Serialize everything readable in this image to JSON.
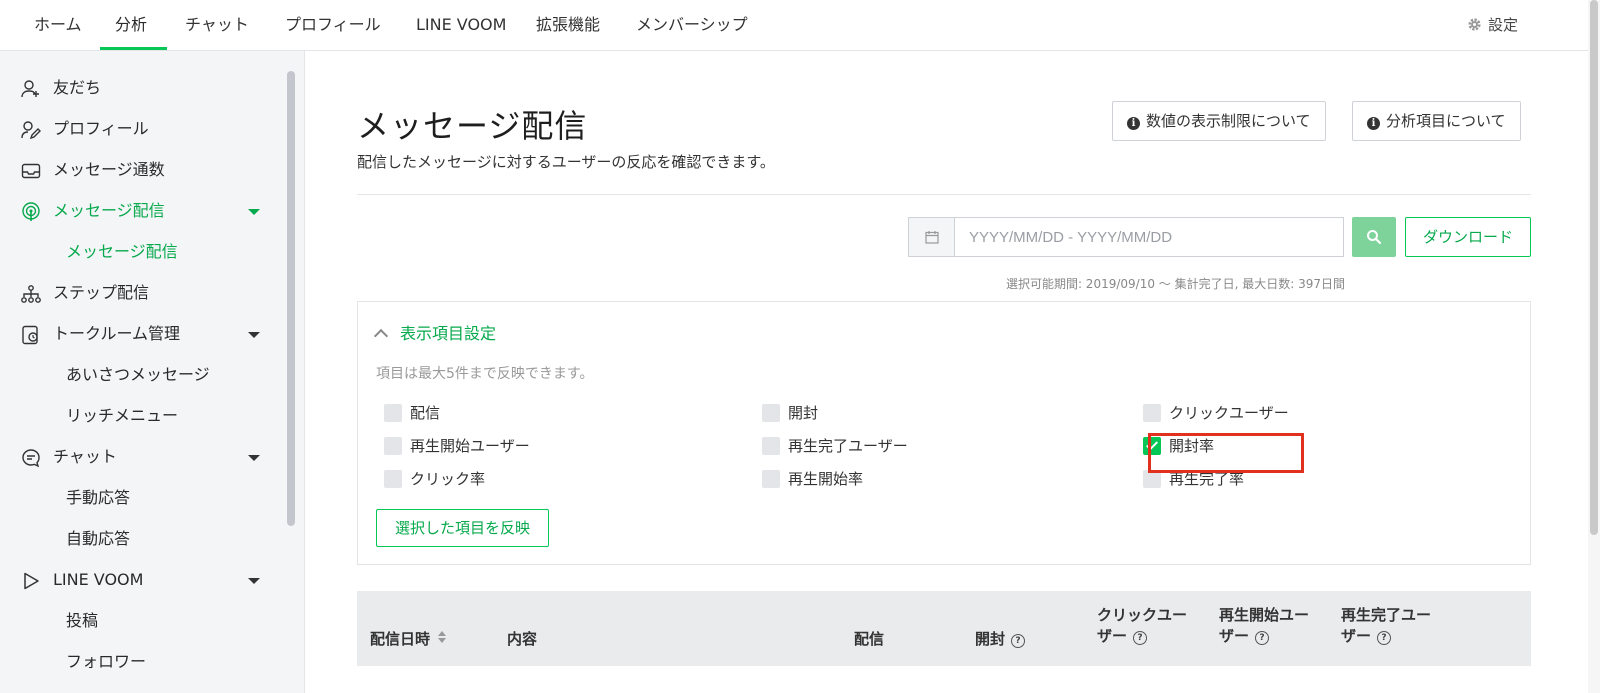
{
  "nav": {
    "tabs": [
      {
        "label": "ホーム"
      },
      {
        "label": "分析"
      },
      {
        "label": "チャット"
      },
      {
        "label": "プロフィール"
      },
      {
        "label": "LINE VOOM"
      },
      {
        "label": "拡張機能"
      },
      {
        "label": "メンバーシップ"
      }
    ],
    "active_tab": "分析",
    "settings_label": "設定"
  },
  "sidebar": {
    "items": [
      {
        "label": "友だち",
        "icon": "user-plus-icon"
      },
      {
        "label": "プロフィール",
        "icon": "profile-edit-icon"
      },
      {
        "label": "メッセージ通数",
        "icon": "inbox-icon"
      },
      {
        "label": "メッセージ配信",
        "icon": "broadcast-icon",
        "active": true
      },
      {
        "label": "メッセージ配信",
        "sub": true,
        "active": true
      },
      {
        "label": "ステップ配信",
        "icon": "step-tree-icon"
      },
      {
        "label": "トークルーム管理",
        "icon": "talkroom-icon"
      },
      {
        "label": "あいさつメッセージ",
        "sub": true
      },
      {
        "label": "リッチメニュー",
        "sub": true
      },
      {
        "label": "チャット",
        "icon": "chat-bubble-icon"
      },
      {
        "label": "手動応答",
        "sub": true
      },
      {
        "label": "自動応答",
        "sub": true
      },
      {
        "label": "LINE VOOM",
        "icon": "voom-play-icon"
      },
      {
        "label": "投稿",
        "sub": true
      },
      {
        "label": "フォロワー",
        "sub": true
      }
    ]
  },
  "main": {
    "title": "メッセージ配信",
    "subtitle": "配信したメッセージに対するユーザーの反応を確認できます。",
    "info_buttons": [
      "数値の表示制限について",
      "分析項目について"
    ],
    "date_placeholder": "YYYY/MM/DD - YYYY/MM/DD",
    "download_label": "ダウンロード",
    "period_note": "選択可能期間: 2019/09/10 〜 集計完了日, 最大日数: 397日間"
  },
  "display_settings": {
    "title": "表示項目設定",
    "note": "項目は最大5件まで反映できます。",
    "options": [
      {
        "label": "配信",
        "checked": false
      },
      {
        "label": "開封",
        "checked": false
      },
      {
        "label": "クリックユーザー",
        "checked": false
      },
      {
        "label": "再生開始ユーザー",
        "checked": false
      },
      {
        "label": "再生完了ユーザー",
        "checked": false
      },
      {
        "label": "開封率",
        "checked": true
      },
      {
        "label": "クリック率",
        "checked": false
      },
      {
        "label": "再生開始率",
        "checked": false
      },
      {
        "label": "再生完了率",
        "checked": false
      }
    ],
    "apply_label": "選択した項目を反映",
    "highlight_color": "#e0301e"
  },
  "table": {
    "headers": {
      "date": "配信日時",
      "content": "内容",
      "delivery": "配信",
      "open": "開封",
      "click_user_1": "クリックユー",
      "click_user_2": "ザー",
      "play_start_1": "再生開始ユー",
      "play_start_2": "ザー",
      "play_done_1": "再生完了ユー",
      "play_done_2": "ザー"
    }
  },
  "colors": {
    "accent": "#06c755",
    "accent_text": "#06a94c"
  }
}
